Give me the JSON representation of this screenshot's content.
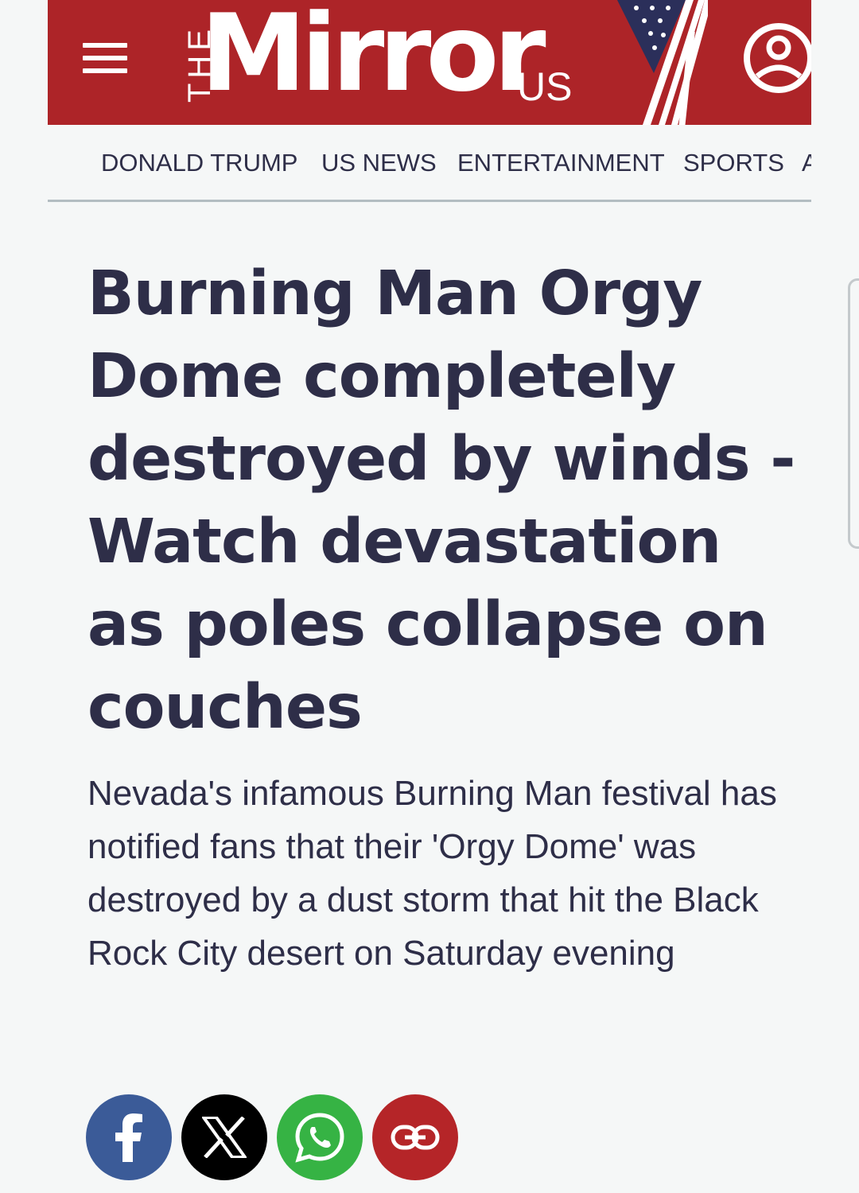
{
  "header": {
    "brand_prefix": "THE",
    "brand_name": "Mirror",
    "brand_suffix": "US",
    "menu_icon": "hamburger-icon",
    "account_icon": "user-account-icon",
    "brand_color": "#ad2428"
  },
  "nav": {
    "items": [
      "DONALD TRUMP",
      "US NEWS",
      "ENTERTAINMENT",
      "SPORTS",
      "A"
    ]
  },
  "article": {
    "headline": "Burning Man Orgy Dome completely destroyed by winds - Watch devastation as poles collapse on couches",
    "standfirst": "Nevada's infamous Burning Man festival has notified fans that their 'Orgy Dome' was destroyed by a dust storm that hit the Black Rock City desert on Saturday evening"
  },
  "share": {
    "buttons": [
      {
        "icon": "facebook-icon",
        "color": "#3b5b98"
      },
      {
        "icon": "x-icon",
        "color": "#000000"
      },
      {
        "icon": "whatsapp-icon",
        "color": "#36b344"
      },
      {
        "icon": "link-icon",
        "color": "#b52528"
      }
    ]
  }
}
